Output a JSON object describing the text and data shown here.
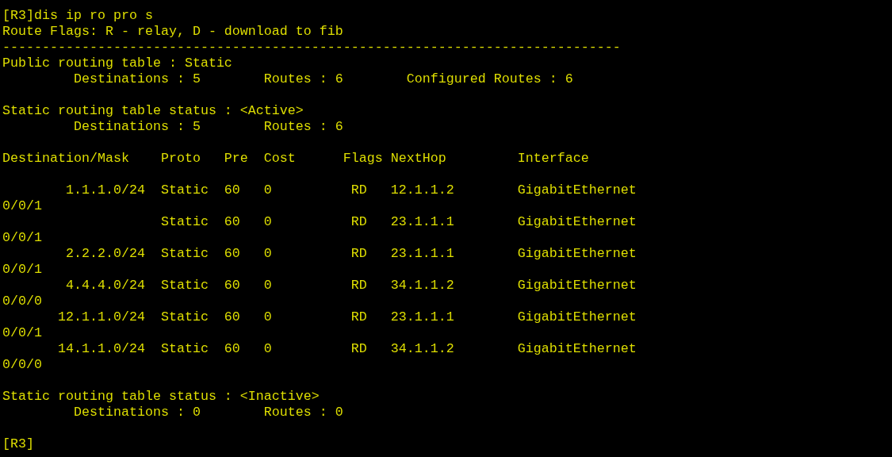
{
  "terminal": {
    "blocks": [
      {
        "lines": [
          "[R3]dis ip ro pro s",
          "Route Flags: R - relay, D - download to fib",
          "------------------------------------------------------------------------------",
          "Public routing table : Static",
          "         Destinations : 5        Routes : 6        Configured Routes : 6"
        ]
      },
      {
        "lines": [
          "Static routing table status : <Active>",
          "         Destinations : 5        Routes : 6"
        ]
      },
      {
        "lines": [
          "Destination/Mask    Proto   Pre  Cost      Flags NextHop         Interface"
        ]
      },
      {
        "lines": [
          "        1.1.1.0/24  Static  60   0          RD   12.1.1.2        GigabitEthernet",
          "0/0/1",
          "                    Static  60   0          RD   23.1.1.1        GigabitEthernet",
          "0/0/1",
          "        2.2.2.0/24  Static  60   0          RD   23.1.1.1        GigabitEthernet",
          "0/0/1",
          "        4.4.4.0/24  Static  60   0          RD   34.1.1.2        GigabitEthernet",
          "0/0/0",
          "       12.1.1.0/24  Static  60   0          RD   23.1.1.1        GigabitEthernet",
          "0/0/1",
          "       14.1.1.0/24  Static  60   0          RD   34.1.1.2        GigabitEthernet",
          "0/0/0"
        ]
      },
      {
        "lines": [
          "Static routing table status : <Inactive>",
          "         Destinations : 0        Routes : 0"
        ]
      },
      {
        "lines": [
          "[R3]"
        ]
      }
    ]
  }
}
